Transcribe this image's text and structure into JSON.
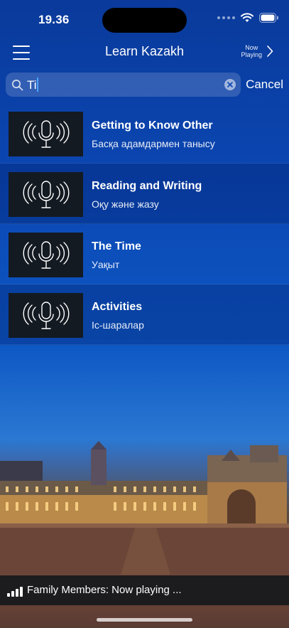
{
  "status_bar": {
    "time": "19.36"
  },
  "navbar": {
    "title": "Learn Kazakh",
    "now_playing": "Now\nPlaying"
  },
  "search": {
    "value": "Ti",
    "cancel_label": "Cancel"
  },
  "results": [
    {
      "title": "Getting to Know Other",
      "subtitle": "Басқа адамдармен танысу"
    },
    {
      "title": "Reading and Writing",
      "subtitle": "Оқу және жазу"
    },
    {
      "title": "The Time",
      "subtitle": "Уақыт"
    },
    {
      "title": "Activities",
      "subtitle": "Іс-шаралар"
    }
  ],
  "player": {
    "text": "Family Members: Now playing ..."
  },
  "icons": {
    "menu": "hamburger-menu-icon",
    "chevron": "chevron-right-icon",
    "search": "search-icon",
    "clear": "clear-icon",
    "thumbnail": "microphone-broadcast-icon",
    "player": "playing-bars-icon"
  },
  "colors": {
    "background_top": "#0a3a9b",
    "player_bar": "#1c1c1e",
    "thumbnail": "#141a22",
    "caret": "#4da3ff"
  }
}
